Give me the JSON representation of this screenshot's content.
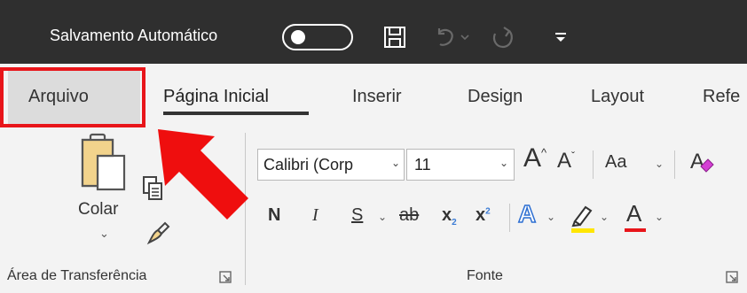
{
  "titlebar": {
    "autosave_label": "Salvamento Automático",
    "autosave_state": "Desativado",
    "colors": {
      "background": "#2f2f2f",
      "text": "#ffffff"
    }
  },
  "tabs": [
    {
      "label": "Arquivo",
      "highlighted": true
    },
    {
      "label": "Página Inicial",
      "selected": true
    },
    {
      "label": "Inserir"
    },
    {
      "label": "Design"
    },
    {
      "label": "Layout"
    },
    {
      "label": "Refe"
    }
  ],
  "ribbon": {
    "clipboard": {
      "paste_label": "Colar",
      "group_label": "Área de Transferência"
    },
    "font": {
      "font_name": "Calibri (Corp",
      "font_size": "11",
      "change_case": "Aa",
      "bold": "N",
      "italic": "I",
      "underline": "S",
      "strikethrough": "ab",
      "subscript": "x",
      "superscript": "x",
      "text_effects": "A",
      "font_color": "A",
      "grow_font": "A",
      "shrink_font": "A",
      "group_label": "Fonte",
      "highlight_color": "#ffe600",
      "font_color_value": "#e8151a"
    }
  },
  "annotation": {
    "color": "#e8151a"
  },
  "icons": [
    "save-icon",
    "undo-icon",
    "redo-icon",
    "customize-quick-access-icon",
    "paste-icon",
    "copy-icon",
    "format-painter-icon",
    "clear-formatting-icon",
    "highlighter-icon",
    "dialog-launcher-icon"
  ]
}
